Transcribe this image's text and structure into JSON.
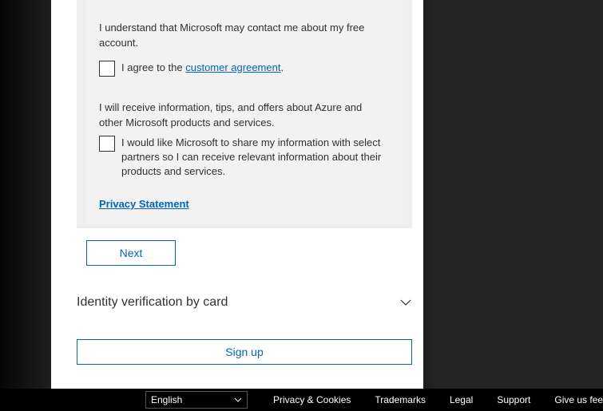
{
  "form": {
    "contact_understanding": "I understand that Microsoft may contact me about my free account.",
    "agree_prefix": "I agree to the ",
    "agree_link": "customer agreement",
    "agree_suffix": ".",
    "offers_text": "I will receive information, tips, and offers about Azure and other Microsoft products and services.",
    "share_text": "I would like Microsoft to share my information with select partners so I can receive relevant information about their products and services.",
    "privacy": "Privacy Statement",
    "next": "Next"
  },
  "identity": {
    "title": "Identity verification by card"
  },
  "signup": "Sign up",
  "footer": {
    "language": "English",
    "links": {
      "privacy": "Privacy & Cookies",
      "trademarks": "Trademarks",
      "legal": "Legal",
      "support": "Support",
      "feedback": "Give us feed"
    }
  }
}
